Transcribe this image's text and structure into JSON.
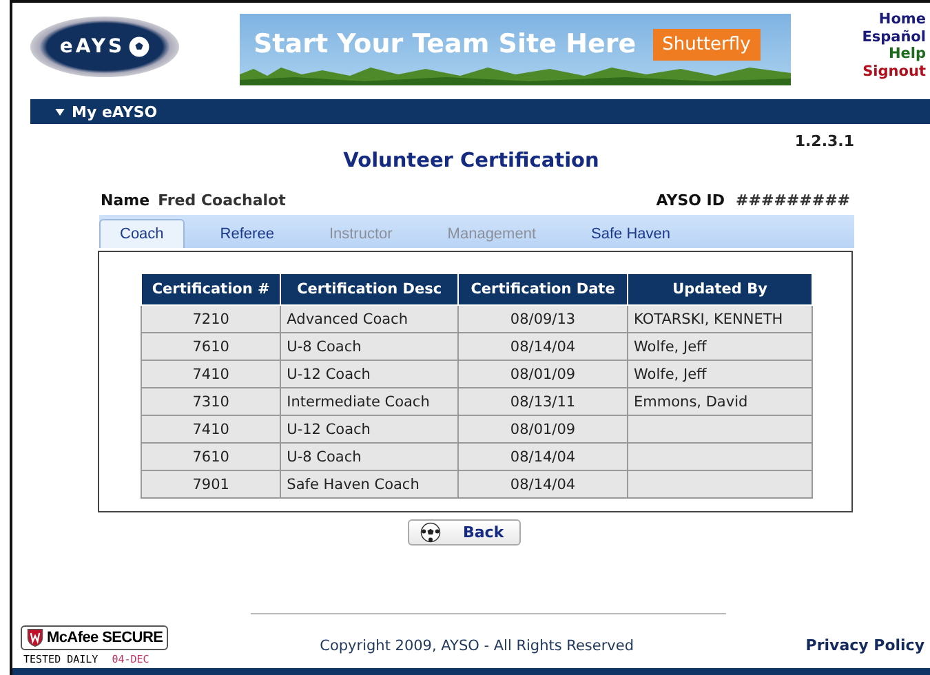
{
  "header": {
    "logo_text": "eAYS",
    "banner": {
      "headline": "Start Your Team Site Here",
      "button": "Shutterfly"
    },
    "links": [
      {
        "label": "Home",
        "color": "#1a1a7a"
      },
      {
        "label": "Español",
        "color": "#1a1a7a"
      },
      {
        "label": "Help",
        "color": "#1e6b1e"
      },
      {
        "label": "Signout",
        "color": "#b0101e"
      }
    ]
  },
  "nav": {
    "menu": "My eAYSO"
  },
  "version": "1.2.3.1",
  "title": "Volunteer Certification",
  "name_label": "Name",
  "name_value": "Fred Coachalot",
  "id_label": "AYSO ID",
  "id_value": "#########",
  "tabs": [
    {
      "label": "Coach",
      "selected": true,
      "disabled": false
    },
    {
      "label": "Referee",
      "selected": false,
      "disabled": false
    },
    {
      "label": "Instructor",
      "selected": false,
      "disabled": true
    },
    {
      "label": "Management",
      "selected": false,
      "disabled": true
    },
    {
      "label": "Safe Haven",
      "selected": false,
      "disabled": false
    }
  ],
  "table": {
    "columns": [
      "Certification #",
      "Certification Desc",
      "Certification Date",
      "Updated By"
    ],
    "rows": [
      [
        "7210",
        "Advanced Coach",
        "08/09/13",
        "KOTARSKI, KENNETH"
      ],
      [
        "7610",
        "U-8 Coach",
        "08/14/04",
        "Wolfe, Jeff"
      ],
      [
        "7410",
        "U-12 Coach",
        "08/01/09",
        "Wolfe, Jeff"
      ],
      [
        "7310",
        "Intermediate Coach",
        "08/13/11",
        "Emmons, David"
      ],
      [
        "7410",
        "U-12 Coach",
        "08/01/09",
        ""
      ],
      [
        "7610",
        "U-8 Coach",
        "08/14/04",
        ""
      ],
      [
        "7901",
        "Safe Haven Coach",
        "08/14/04",
        ""
      ]
    ]
  },
  "back_button": "Back",
  "footer": {
    "badge_title": "McAfee SECURE",
    "badge_tested": "TESTED DAILY",
    "badge_date": "04-DEC",
    "copyright": "Copyright 2009, AYSO - All Rights Reserved",
    "privacy": "Privacy Policy"
  }
}
